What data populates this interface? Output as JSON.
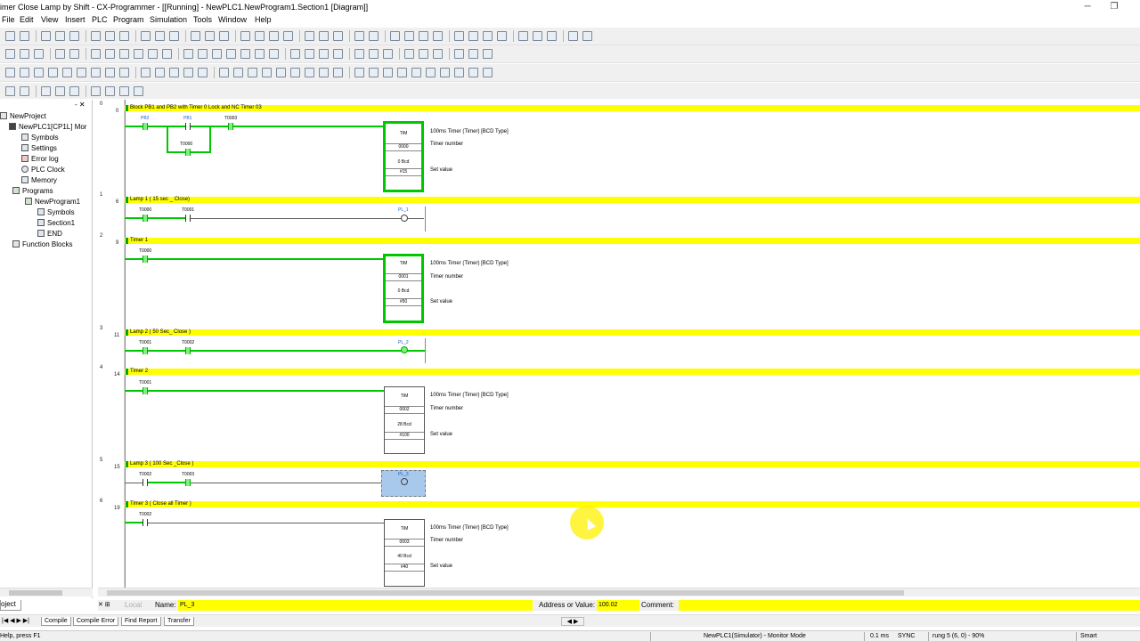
{
  "title_bar": {
    "title": "imer Close Lamp by Shift - CX-Programmer - [[Running] - NewPLC1.NewProgram1.Section1 [Diagram]]"
  },
  "menu": [
    "File",
    "Edit",
    "View",
    "Insert",
    "PLC",
    "Program",
    "Simulation",
    "Tools",
    "Window",
    "Help"
  ],
  "tree": {
    "items": [
      {
        "label": "NewProject",
        "icon": "project-icon"
      },
      {
        "label": "NewPLC1[CP1L] Mor",
        "icon": "plc-icon"
      },
      {
        "label": "Symbols",
        "icon": "symbols-icon"
      },
      {
        "label": "Settings",
        "icon": "settings-icon"
      },
      {
        "label": "Error log",
        "icon": "error-log-icon"
      },
      {
        "label": "PLC Clock",
        "icon": "clock-icon"
      },
      {
        "label": "Memory",
        "icon": "memory-icon"
      },
      {
        "label": "Programs",
        "icon": "programs-icon"
      },
      {
        "label": "NewProgram1",
        "icon": "program-icon"
      },
      {
        "label": "Symbols",
        "icon": "symbols-icon"
      },
      {
        "label": "Section1",
        "icon": "section-icon"
      },
      {
        "label": "END",
        "icon": "section-icon"
      },
      {
        "label": "Function Blocks",
        "icon": "function-blocks-icon"
      }
    ],
    "tab": "oject"
  },
  "rungs": [
    {
      "num": "0",
      "step": "0",
      "comment": "Block PB1 and PB2 with Timer 0 Lock and NC Timer 03"
    },
    {
      "num": "1",
      "step": "6",
      "comment": "Lamp 1 ( 15 sec _ Close)"
    },
    {
      "num": "2",
      "step": "9",
      "comment": "Timer 1"
    },
    {
      "num": "3",
      "step": "11",
      "comment": "Lamp 2 ( 50 Sec_ Close )"
    },
    {
      "num": "4",
      "step": "14",
      "comment": "Timer 2"
    },
    {
      "num": "5",
      "step": "15",
      "comment": "Lamp 3 ( 100 Sec _Close )"
    },
    {
      "num": "6",
      "step": "19",
      "comment": "Timer 3 ( Close all Timer )"
    }
  ],
  "contacts": {
    "r0": [
      "PB2",
      "PB1",
      "T0003",
      "T0000"
    ],
    "r1": [
      "T0000",
      "T0001"
    ],
    "r2": [
      "T0000"
    ],
    "r3": [
      "T0001",
      "T0002"
    ],
    "r4": [
      "T0001"
    ],
    "r5": [
      "T0002",
      "T0003"
    ],
    "r6": [
      "T0002"
    ]
  },
  "coils": {
    "r1": "PL_1",
    "r3": "PL_2",
    "r5": "PL_3"
  },
  "timers": [
    {
      "name": "TIM",
      "number": "0000",
      "bcd": "0 Bcd",
      "set": "#15"
    },
    {
      "name": "TIM",
      "number": "0001",
      "bcd": "0 Bcd",
      "set": "#50"
    },
    {
      "name": "TIM",
      "number": "0002",
      "bcd": "28 Bcd",
      "set": "#100"
    },
    {
      "name": "TIM",
      "number": "0003",
      "bcd": "40 Bcd",
      "set": "#40"
    }
  ],
  "timer_desc": {
    "type": "100ms Timer (Timer) [BCD Type]",
    "number": "Timer number",
    "set": "Set value"
  },
  "propbar": {
    "local": "Local",
    "name_label": "Name:",
    "name_value": "PL_3",
    "addr_label": "Address or Value:",
    "addr_value": "100.02",
    "comment_label": "Comment:"
  },
  "output_tabs": [
    "Compile",
    "Compile Error",
    "Find Report",
    "Transfer"
  ],
  "status": {
    "help": "Help, press F1",
    "mode": "NewPLC1(Simulator) - Monitor Mode",
    "cycle": "0.1 ms",
    "sync": "SYNC",
    "pos": "rung 5 (6, 0)  - 90%",
    "input": "Smart"
  },
  "colors": {
    "energized": "#00c800",
    "comment_bg": "#ffff00",
    "selection": "#a8c8ec"
  }
}
